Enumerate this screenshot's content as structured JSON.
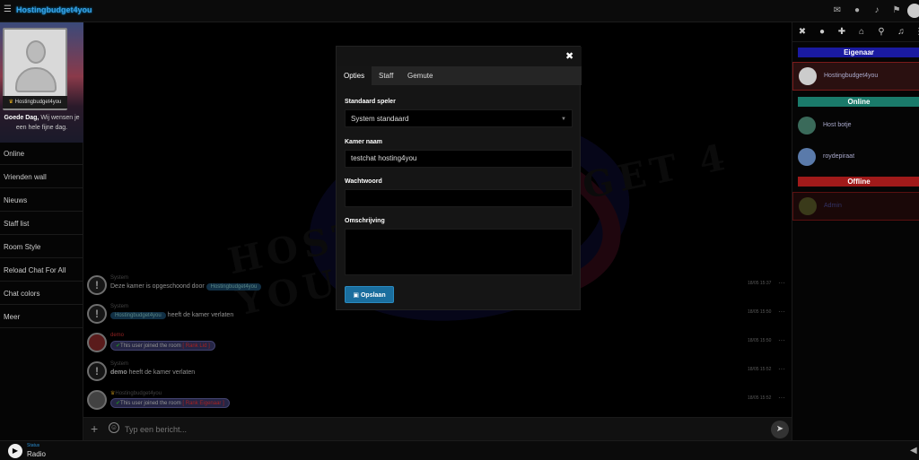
{
  "header": {
    "brand": "Hostingbudget4you",
    "icons": [
      "envelope-icon",
      "user-icon",
      "bell-icon",
      "flag-icon"
    ]
  },
  "profile": {
    "username": "Hostingbudget4you",
    "greeting_bold": "Goede Dag,",
    "greeting_text": "Wij wensen je een hele fijne dag."
  },
  "sidebar": {
    "items": [
      {
        "label": "Online"
      },
      {
        "label": "Vrienden wall"
      },
      {
        "label": "Nieuws"
      },
      {
        "label": "Staff list"
      },
      {
        "label": "Room Style"
      },
      {
        "label": "Reload Chat For All"
      },
      {
        "label": "Chat colors"
      },
      {
        "label": "Meer"
      }
    ]
  },
  "watermark": {
    "text": "HOSTING BUDGET 4 YOU"
  },
  "messages": [
    {
      "name": "System",
      "text": "Deze kamer is opgeschoond door",
      "pill": "Hostingbudget4you",
      "time": "18/05 15:37"
    },
    {
      "name": "System",
      "pill": "Hostingbudget4you",
      "text": "heeft de kamer verlaten",
      "time": "18/05 15:50"
    },
    {
      "name": "demo",
      "joined_prefix": "This user joined the room",
      "rank": "[ Rank Lid ]",
      "time": "18/05 15:50"
    },
    {
      "name": "System",
      "bold": "demo",
      "text": "heeft de kamer verlaten",
      "time": "18/05 15:52"
    },
    {
      "name": "Hostingbudget4you",
      "joined_prefix": "This user joined the room",
      "rank": "[ Rank Eigenaar ]",
      "time": "18/05 15:52"
    }
  ],
  "input": {
    "placeholder": "Typ een bericht..."
  },
  "userlist": {
    "owner_title": "Eigenaar",
    "online_title": "Online",
    "offline_title": "Offline",
    "owner": {
      "name": "Hostingbudget4you"
    },
    "online": [
      {
        "name": "Host botje"
      },
      {
        "name": "roydepiraat"
      }
    ],
    "offline": [
      {
        "name": "Admin"
      }
    ]
  },
  "footer": {
    "status": "Status",
    "radio": "Radio"
  },
  "modal": {
    "tabs": [
      "Opties",
      "Staff",
      "Gemute"
    ],
    "player_label": "Standaard speler",
    "player_value": "System standaard",
    "room_label": "Kamer naam",
    "room_value": "testchat hosting4you",
    "password_label": "Wachtwoord",
    "password_value": "",
    "desc_label": "Omschrijving",
    "desc_value": "",
    "save_label": "Opslaan"
  },
  "colors": {
    "accent": "#1a6e9e",
    "owner": "#1a1aa0",
    "online": "#1a7a6a",
    "offline": "#a01a1a"
  }
}
